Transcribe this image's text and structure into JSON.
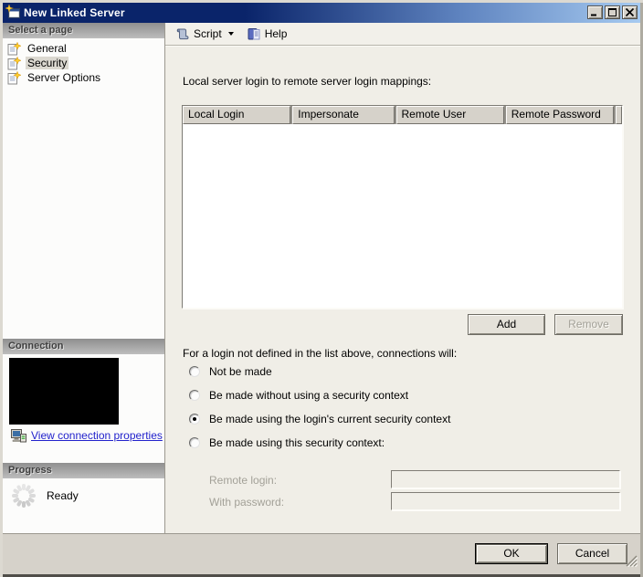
{
  "window": {
    "title": "New Linked Server"
  },
  "window_controls": {
    "minimize": "minimize",
    "maximize": "maximize",
    "close": "close"
  },
  "toolbar": {
    "script": "Script",
    "help": "Help"
  },
  "sidebar": {
    "page_header": "Select a page",
    "pages": [
      {
        "label": "General",
        "selected": false
      },
      {
        "label": "Security",
        "selected": true
      },
      {
        "label": "Server Options",
        "selected": false
      }
    ],
    "connection_header": "Connection",
    "connection_link": "View connection properties",
    "progress_header": "Progress",
    "progress_status": "Ready"
  },
  "main": {
    "mappings_label": "Local server login to remote server login mappings:",
    "columns": [
      "Local Login",
      "Impersonate",
      "Remote User",
      "Remote Password"
    ],
    "rows": [],
    "add": "Add",
    "remove": "Remove",
    "options_label": "For a login not defined in the list above, connections will:",
    "options": [
      "Not be made",
      "Be made without using a security context",
      "Be made using the login's current security context",
      "Be made using this security context:"
    ],
    "selected_option": "Be made using the login's current security context",
    "remote_login_label": "Remote login:",
    "remote_login_value": "",
    "with_password_label": "With password:",
    "with_password_value": ""
  },
  "footer": {
    "ok": "OK",
    "cancel": "Cancel"
  },
  "colors": {
    "titlebar_start": "#0a246a",
    "titlebar_end": "#a6caf0",
    "link": "#2222cc",
    "selected_page_bg": "#dbd8d0",
    "panel_bg": "#f0eee7",
    "chrome_bg": "#d6d2ca"
  }
}
